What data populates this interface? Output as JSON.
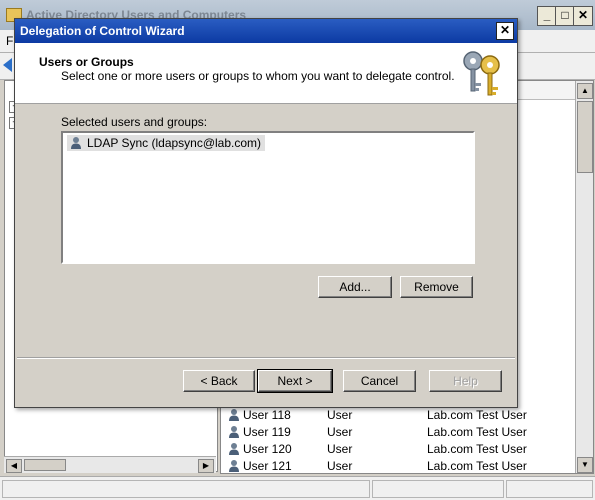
{
  "background_window": {
    "title": "Active Directory Users and Computers",
    "list_rows": [
      {
        "name": "User 118",
        "type": "User",
        "description": "Lab.com Test User"
      },
      {
        "name": "User 119",
        "type": "User",
        "description": "Lab.com Test User"
      },
      {
        "name": "User 120",
        "type": "User",
        "description": "Lab.com Test User"
      },
      {
        "name": "User 121",
        "type": "User",
        "description": "Lab.com Test User"
      }
    ]
  },
  "dialog": {
    "title": "Delegation of Control Wizard",
    "header_title": "Users or Groups",
    "header_subtitle": "Select one or more users or groups to whom you want to delegate control.",
    "selected_label": "Selected users and groups:",
    "selected_items": [
      "LDAP Sync (ldapsync@lab.com)"
    ],
    "add_label": "Add...",
    "remove_label": "Remove",
    "back_label": "< Back",
    "next_label": "Next >",
    "cancel_label": "Cancel",
    "help_label": "Help"
  },
  "icons": {
    "user": "user-icon",
    "keys": "keys-icon",
    "close": "close-icon"
  },
  "colors": {
    "dialog_title_bg": "#0c3aa3",
    "dialog_face": "#d4d0c8",
    "selection_bg": "#e0e0e0"
  }
}
